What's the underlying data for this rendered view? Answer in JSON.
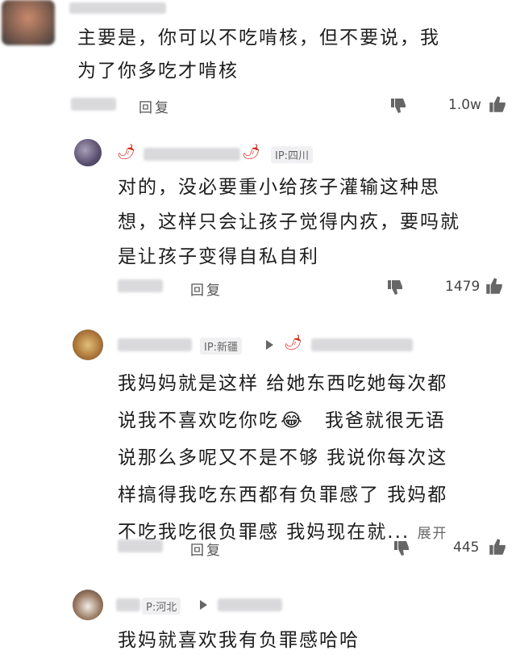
{
  "comment1": {
    "text_line1": "主要是，你可以不吃啃核，但不要说，我",
    "text_line2": "为了你多吃才啃核",
    "reply_label": "回复",
    "like_count": "1.0w"
  },
  "comment2": {
    "ip_label": "IP:四川",
    "text_line1": "对的，没必要重小给孩子灌输这种思",
    "text_line2": "想，这样只会让孩子觉得内疚，要吗就",
    "text_line3": "是让孩子变得自私自利",
    "reply_label": "回复",
    "like_count": "1479"
  },
  "comment3": {
    "ip_label": "IP:新疆",
    "text_line1": "我妈妈就是这样 给她东西吃她每次都",
    "text_line2_a": "说我不喜欢吃你吃",
    "emoji": "😂",
    "text_line2_b": "我爸就很无语",
    "text_line3": "说那么多呢又不是不够 我说你每次这",
    "text_line4": "样搞得我吃东西都有负罪感了  我妈都",
    "text_line5": "不吃我吃很负罪感  我妈现在就...",
    "expand_label": "展开",
    "reply_label": "回复",
    "like_count": "445"
  },
  "comment4": {
    "ip_label": "P:河北",
    "text_line1": "我妈就喜欢我有负罪感哈哈"
  },
  "colors": {
    "accent_red": "#d62a1e",
    "ip_bg": "#f0f0f2",
    "text": "#1d1d1d"
  }
}
